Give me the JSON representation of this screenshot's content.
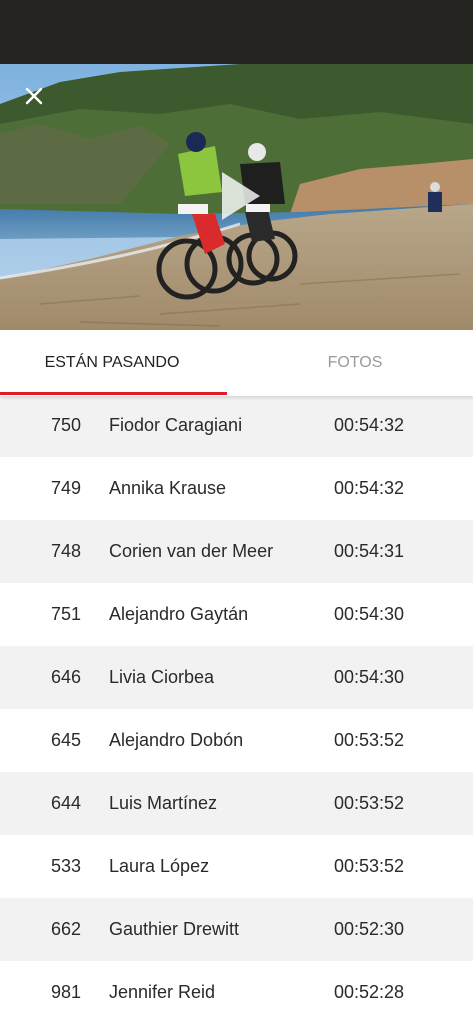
{
  "tabs": [
    {
      "label": "ESTÁN PASANDO",
      "active": true
    },
    {
      "label": "FOTOS",
      "active": false
    }
  ],
  "colors": {
    "accent": "#e0192b",
    "status_bar": "#262420"
  },
  "media": {
    "close_icon": "close-icon",
    "play_icon": "play-icon"
  },
  "riders": [
    {
      "bib": "750",
      "name": "Fiodor Caragiani",
      "time": "00:54:32"
    },
    {
      "bib": "749",
      "name": "Annika Krause",
      "time": "00:54:32"
    },
    {
      "bib": "748",
      "name": "Corien van der Meer",
      "time": "00:54:31"
    },
    {
      "bib": "751",
      "name": "Alejandro Gaytán",
      "time": "00:54:30"
    },
    {
      "bib": "646",
      "name": "Livia Ciorbea",
      "time": "00:54:30"
    },
    {
      "bib": "645",
      "name": "Alejandro Dobón",
      "time": "00:53:52"
    },
    {
      "bib": "644",
      "name": "Luis Martínez",
      "time": "00:53:52"
    },
    {
      "bib": "533",
      "name": "Laura López",
      "time": "00:53:52"
    },
    {
      "bib": "662",
      "name": "Gauthier Drewitt",
      "time": "00:52:30"
    },
    {
      "bib": "981",
      "name": "Jennifer Reid",
      "time": "00:52:28"
    }
  ]
}
